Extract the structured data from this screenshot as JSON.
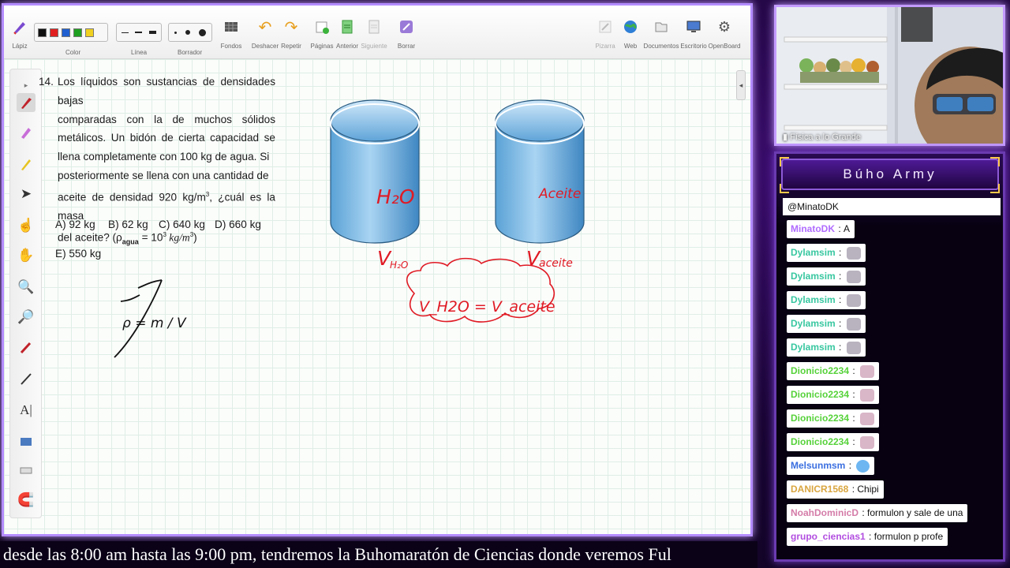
{
  "toolbar": {
    "tools": [
      {
        "label": "Lápiz",
        "icon": "pen-icon"
      },
      {
        "label": "Color",
        "icon": "color-swatches"
      },
      {
        "label": "Línea",
        "icon": "line-style-icon"
      },
      {
        "label": "Borrador",
        "icon": "eraser-size-icon"
      },
      {
        "label": "Fondos",
        "icon": "background-icon"
      },
      {
        "label": "Deshacer",
        "icon": "undo-icon"
      },
      {
        "label": "Repetir",
        "icon": "redo-icon"
      },
      {
        "label": "Páginas",
        "icon": "pages-icon"
      },
      {
        "label": "Anterior",
        "icon": "previous-icon"
      },
      {
        "label": "Siguiente",
        "icon": "next-icon"
      },
      {
        "label": "Borrar",
        "icon": "clear-icon"
      }
    ],
    "right_tools": [
      {
        "label": "Pizarra",
        "icon": "whiteboard-icon"
      },
      {
        "label": "Web",
        "icon": "globe-icon"
      },
      {
        "label": "Documentos",
        "icon": "folder-icon"
      },
      {
        "label": "Escritorio",
        "icon": "desktop-icon"
      },
      {
        "label": "OpenBoard",
        "icon": "settings-gear-icon"
      }
    ],
    "colors": [
      "#111111",
      "#e02020",
      "#1f5fd0",
      "#20a020",
      "#f0d020"
    ]
  },
  "problem": {
    "number": "14.",
    "line1": "Los líquidos son sustancias de densidades bajas",
    "line2": "comparadas con la de muchos sólidos",
    "line3": "metálicos. Un bidón de cierta capacidad se",
    "line4": "llena completamente con 100 kg de agua. Si",
    "line5": "posteriormente se llena con una cantidad de",
    "line6a": "aceite de densidad 920 kg/m",
    "line6b": "3",
    "line6c": ", ¿cuál es la masa",
    "line7a": "del aceite? (ρ",
    "line7b": "agua",
    "line7c": " = 10",
    "line7d": "3",
    "line7e": " kg/m",
    "line7f": "3",
    "line7g": ")",
    "options": [
      "A) 92 kg",
      "B) 62 kg",
      "C) 640 kg",
      "D) 660 kg",
      "E) 550 kg"
    ]
  },
  "ink": {
    "h2o_label": "H₂O",
    "aceite_label": "Aceite",
    "v_h2o": "V",
    "v_h2o_sub": "H₂O",
    "v_aceite": "V",
    "v_aceite_sub": "aceite",
    "equation": "V_H2O = V_aceite",
    "density_formula": "ρ = m / V"
  },
  "webcam": {
    "label": "Física a lo Grande"
  },
  "chat": {
    "header": "Búho Army",
    "pinned": "@MinatoDK",
    "messages": [
      {
        "user": "MinatoDK",
        "color": "#b06cff",
        "text": "A",
        "emote": ""
      },
      {
        "user": "Dylamsim",
        "color": "#38c7a0",
        "text": "",
        "emote": "cat"
      },
      {
        "user": "Dylamsim",
        "color": "#38c7a0",
        "text": "",
        "emote": "cat"
      },
      {
        "user": "Dylamsim",
        "color": "#38c7a0",
        "text": "",
        "emote": "cat"
      },
      {
        "user": "Dylamsim",
        "color": "#38c7a0",
        "text": "",
        "emote": "cat"
      },
      {
        "user": "Dylamsim",
        "color": "#38c7a0",
        "text": "",
        "emote": "cat"
      },
      {
        "user": "Dionicio2234",
        "color": "#56d23a",
        "text": "",
        "emote": "pig"
      },
      {
        "user": "Dionicio2234",
        "color": "#56d23a",
        "text": "",
        "emote": "pig"
      },
      {
        "user": "Dionicio2234",
        "color": "#56d23a",
        "text": "",
        "emote": "pig"
      },
      {
        "user": "Dionicio2234",
        "color": "#56d23a",
        "text": "",
        "emote": "pig"
      },
      {
        "user": "Melsunmsm",
        "color": "#3b6fe0",
        "text": "",
        "emote": "fish"
      },
      {
        "user": "DANICR1568",
        "color": "#d9a640",
        "text": "Chipi",
        "emote": ""
      },
      {
        "user": "NoahDominicD",
        "color": "#d47ca8",
        "text": "formulon y sale de una",
        "emote": ""
      },
      {
        "user": "grupo_ciencias1",
        "color": "#b24ee0",
        "text": "formulon p profe",
        "emote": ""
      }
    ]
  },
  "ticker": {
    "text": "desde las 8:00 am hasta las 9:00 pm, tendremos la Buhomaratón de Ciencias donde veremos Ful"
  }
}
